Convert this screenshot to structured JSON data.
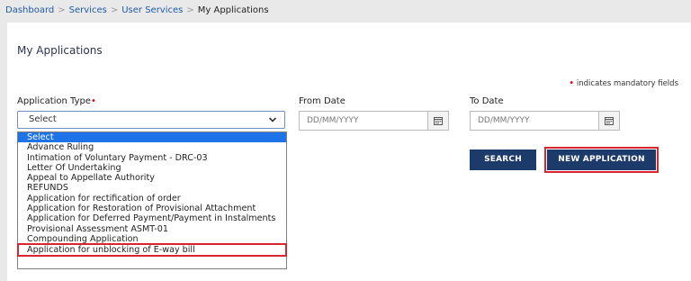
{
  "breadcrumb": {
    "items": [
      "Dashboard",
      "Services",
      "User Services"
    ],
    "separator": ">",
    "current": "My Applications"
  },
  "page": {
    "title": "My Applications",
    "mandatory_star": "•",
    "mandatory_note": "indicates mandatory fields"
  },
  "form": {
    "application_type": {
      "label": "Application Type",
      "required_star": "•",
      "selected_value": "Select"
    },
    "from_date": {
      "label": "From Date",
      "placeholder": "DD/MM/YYYY"
    },
    "to_date": {
      "label": "To Date",
      "placeholder": "DD/MM/YYYY"
    },
    "search_label": "SEARCH",
    "new_application_label": "NEW APPLICATION"
  },
  "dropdown": {
    "options": [
      "Select",
      "Advance Ruling",
      "Intimation of Voluntary Payment - DRC-03",
      "Letter Of Undertaking",
      "Appeal to Appellate Authority",
      "REFUNDS",
      "Application for rectification of order",
      "Application for Restoration of Provisional Attachment",
      "Application for Deferred Payment/Payment in Instalments",
      "Provisional Assessment ASMT-01",
      "Compounding Application",
      "Application for unblocking of E-way bill"
    ]
  },
  "icons": {
    "chevron": "chevron-down-icon",
    "calendar": "calendar-icon"
  },
  "colors": {
    "primary_button": "#1d3b6a",
    "highlight_border": "#d9262e",
    "selected_option": "#1e73e8",
    "link": "#1f5aa6",
    "required": "#d0021b"
  }
}
